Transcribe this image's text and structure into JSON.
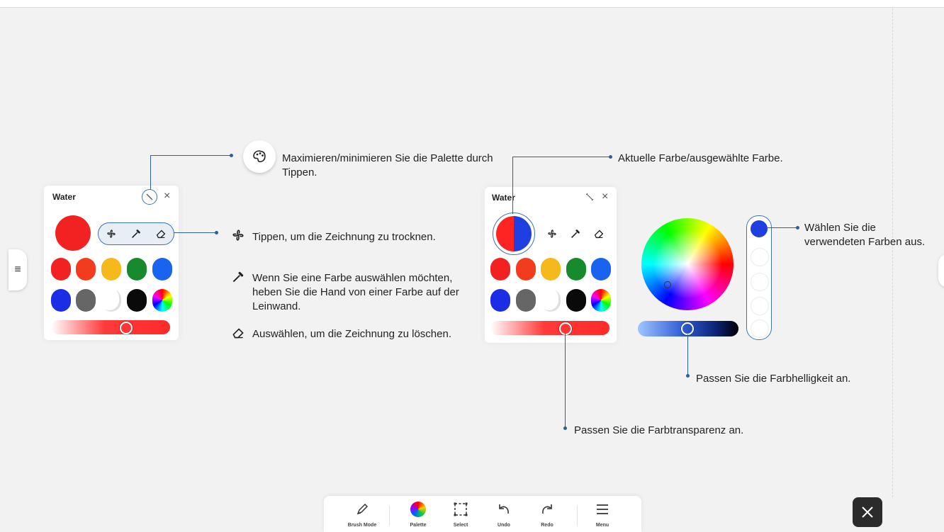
{
  "colors": {
    "accent": "#2f5f97",
    "red": "#ff2424",
    "blue": "#1f3fe0"
  },
  "left_palette": {
    "title": "Water",
    "close": "×",
    "swatches_row1": [
      "#f32222",
      "#f33c1e",
      "#f6b91c",
      "#168a2c",
      "#1a63f0"
    ],
    "swatches_row2": [
      "#1b2ee6",
      "#666666",
      "#ffffff",
      "#0a0a0a",
      "spectrum"
    ]
  },
  "right_palette": {
    "title": "Water",
    "close": "×",
    "swatches_row1": [
      "#f32222",
      "#f33c1e",
      "#f6b91c",
      "#168a2c",
      "#1a63f0"
    ],
    "swatches_row2": [
      "#1b2ee6",
      "#666666",
      "#ffffff",
      "#0a0a0a",
      "spectrum"
    ]
  },
  "callouts": {
    "palette_toggle": "Maximieren/minimieren Sie die Palette durch Tippen.",
    "dry": "Tippen, um die Zeichnung zu trocknen.",
    "pick_color": "Wenn Sie eine Farbe auswählen möchten, heben Sie die Hand von einer Farbe auf der Leinwand.",
    "erase": "Auswählen, um die Zeichnung zu löschen.",
    "current_color": "Aktuelle Farbe/ausgewählte Farbe.",
    "recent_colors": "Wählen Sie die verwendeten Farben aus.",
    "brightness": "Passen Sie die Farbhelligkeit an.",
    "transparency": "Passen Sie die Farbtransparenz an."
  },
  "toolbar": {
    "brush": "Brush Mode",
    "palette": "Palette",
    "select": "Select",
    "undo": "Undo",
    "redo": "Redo",
    "menu": "Menu"
  },
  "side_menu_icon": "≡"
}
